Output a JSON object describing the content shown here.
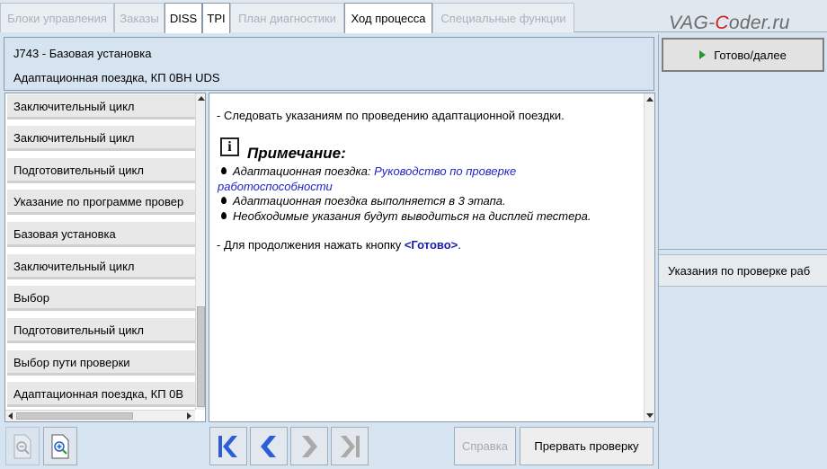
{
  "tabs": [
    {
      "label": "Блоки управления",
      "active": false
    },
    {
      "label": "Заказы",
      "active": false
    },
    {
      "label": "DISS",
      "active": true
    },
    {
      "label": "TPI",
      "active": true
    },
    {
      "label": "План диагностики",
      "active": false
    },
    {
      "label": "Ход процесса",
      "active": true
    },
    {
      "label": "Специальные функции",
      "active": false
    }
  ],
  "watermark": {
    "prefix": "VAG-",
    "accent": "C",
    "suffix": "oder.ru"
  },
  "header": {
    "title": "J743 - Базовая установка",
    "subtitle": "Адаптационная поездка, КП 0BH UDS"
  },
  "right_panel": {
    "ready_button": "Готово/далее",
    "instructions_button": "Указания по проверке раб"
  },
  "steps": [
    "Заключительный цикл",
    "Заключительный цикл",
    "Подготовительный цикл",
    "Указание по программе провер",
    "Базовая установка",
    "Заключительный цикл",
    "Выбор",
    "Подготовительный цикл",
    "Выбор пути проверки",
    "Адаптационная поездка, КП 0B"
  ],
  "content": {
    "line1": "- Следовать указаниям по проведению адаптационной поездки.",
    "info_icon": "i",
    "note_title": "Примечание:",
    "bullet1_prefix": "Адаптационная поездка: ",
    "bullet1_link_a": "Руководство по проверке",
    "bullet1_link_b": "работоспособности",
    "bullet2": "Адаптационная поездка выполняется в 3 этапа.",
    "bullet3": "Необходимые указания будут выводиться на дисплей тестера.",
    "continue_prefix": "- Для продолжения нажать кнопку ",
    "continue_button_ref": "<Готово>",
    "continue_suffix": "."
  },
  "bottombar": {
    "help_button": "Справка",
    "abort_button": "Прервать проверку"
  },
  "icons": {
    "zoom_out": "zoom-out-icon",
    "zoom_in": "zoom-in-icon",
    "first": "skip-to-first-icon",
    "prev": "previous-icon",
    "next": "next-icon",
    "last": "skip-to-last-icon",
    "play": "play-icon"
  },
  "colors": {
    "accent_blue": "#2a5fd8",
    "link_blue": "#2323c8",
    "play_green": "#1e9a2e",
    "panel_bg": "#d6e3f0"
  }
}
